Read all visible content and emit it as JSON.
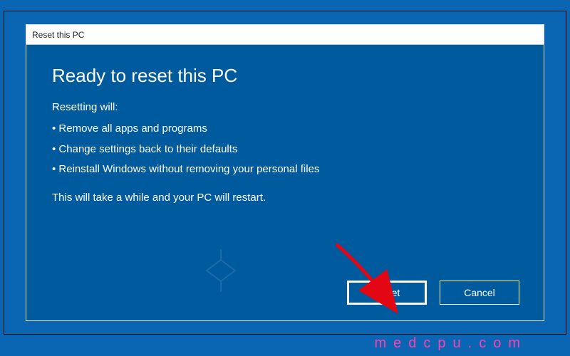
{
  "dialog": {
    "title": "Reset this PC",
    "heading": "Ready to reset this PC",
    "subheading": "Resetting will:",
    "bullets": [
      "Remove all apps and programs",
      "Change settings back to their defaults",
      "Reinstall Windows without removing your personal files"
    ],
    "footnote": "This will take a while and your PC will restart.",
    "buttons": {
      "reset": "Reset",
      "cancel": "Cancel"
    }
  },
  "annotation": {
    "arrow_color": "#e30613"
  },
  "watermark": {
    "site_text": "medcpu.com"
  },
  "colors": {
    "dialog_bg": "#005a9e",
    "page_bg": "#0a66b3",
    "text": "#ffffff"
  }
}
